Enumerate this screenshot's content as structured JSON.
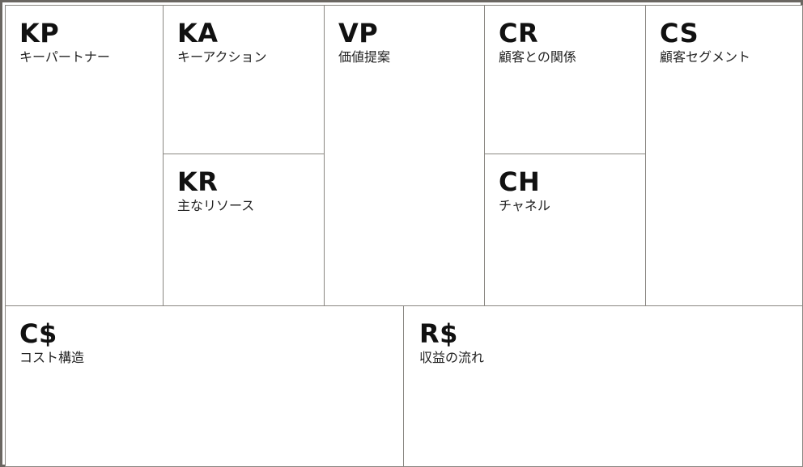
{
  "blocks": {
    "kp": {
      "code": "KP",
      "label": "キーパートナー"
    },
    "ka": {
      "code": "KA",
      "label": "キーアクション"
    },
    "kr": {
      "code": "KR",
      "label": "主なリソース"
    },
    "vp": {
      "code": "VP",
      "label": "価値提案"
    },
    "cr": {
      "code": "CR",
      "label": "顧客との関係"
    },
    "ch": {
      "code": "CH",
      "label": "チャネル"
    },
    "cs": {
      "code": "CS",
      "label": "顧客セグメント"
    },
    "cost": {
      "code": "C$",
      "label": "コスト構造"
    },
    "rev": {
      "code": "R$",
      "label": "収益の流れ"
    }
  },
  "colors": {
    "outer_border": "#6a6661",
    "inner_border": "#8a8782",
    "text": "#111111",
    "background": "#ffffff"
  }
}
